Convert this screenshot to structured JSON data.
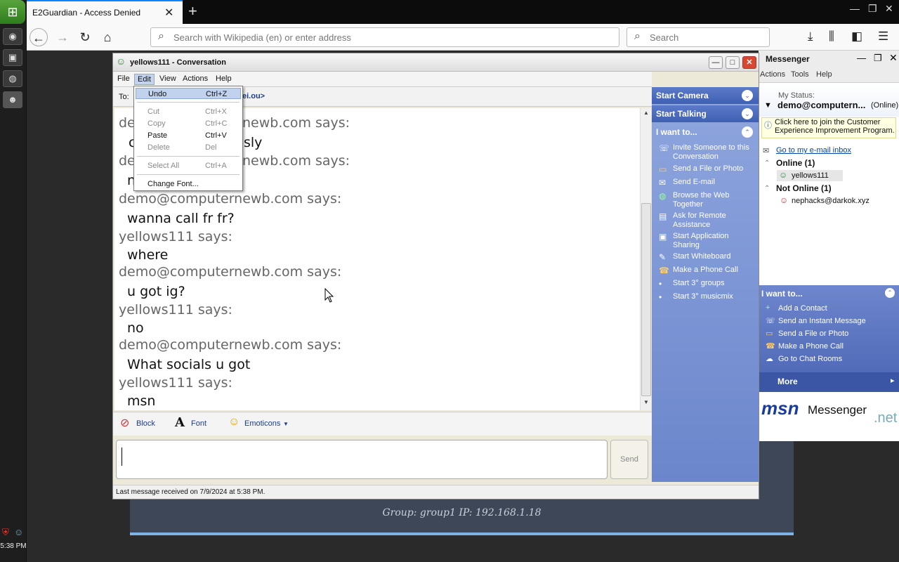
{
  "browser": {
    "tab_title": "E2Guardian - Access Denied",
    "tab_close": "✕",
    "new_tab": "+",
    "url_placeholder": "Search with Wikipedia (en) or enter address",
    "search_placeholder": "Search"
  },
  "taskbar": {
    "clock": "5:38 PM"
  },
  "background_panel": {
    "text": "Group: group1   IP: 192.168.1.18"
  },
  "conversation": {
    "title": "yellows111 - Conversation",
    "menu": [
      "File",
      "Edit",
      "View",
      "Actions",
      "Help"
    ],
    "to_label": "To:",
    "to_suffix": "ei.ou>",
    "messages": [
      {
        "sender": "demo@computernewb.com says:",
        "text": "casually"
      },
      {
        "sender": "demo@computernewb.com says:",
        "text": "n"
      },
      {
        "sender": "demo@computernewb.com says:",
        "text": "wanna call fr fr?"
      },
      {
        "sender": "yellows111 says:",
        "text": "where"
      },
      {
        "sender": "demo@computernewb.com says:",
        "text": "u got ig?"
      },
      {
        "sender": "yellows111 says:",
        "text": "no"
      },
      {
        "sender": "demo@computernewb.com says:",
        "text": "What socials u got"
      },
      {
        "sender": "yellows111 says:",
        "text": "msn"
      }
    ],
    "visible_fragments": {
      "line1_tail": "sly",
      "sender_tail_1": "newb.com says:",
      "sender_tail_2": "newb.com says:",
      "prefix_1": "c",
      "prefix_2": "de",
      "prefix_3": "de"
    },
    "toolbar": {
      "block": "Block",
      "font": "Font",
      "emoticons": "Emoticons"
    },
    "send_label": "Send",
    "status_text": "Last message received on 7/9/2024 at 5:38 PM."
  },
  "edit_menu": {
    "items": [
      {
        "label": "Undo",
        "shortcut": "Ctrl+Z",
        "enabled": true,
        "highlighted": true
      },
      {
        "label": "Cut",
        "shortcut": "Ctrl+X",
        "enabled": false
      },
      {
        "label": "Copy",
        "shortcut": "Ctrl+C",
        "enabled": false
      },
      {
        "label": "Paste",
        "shortcut": "Ctrl+V",
        "enabled": true
      },
      {
        "label": "Delete",
        "shortcut": "Del",
        "enabled": false
      },
      {
        "label": "Select All",
        "shortcut": "Ctrl+A",
        "enabled": false
      },
      {
        "label": "Change Font...",
        "shortcut": "",
        "enabled": true
      }
    ]
  },
  "conv_side": {
    "start_camera": "Start Camera",
    "start_talking": "Start Talking",
    "i_want_to": "I want to...",
    "actions": [
      "Invite Someone to this Conversation",
      "Send a File or Photo",
      "Send E-mail",
      "Browse the Web Together",
      "Ask for Remote Assistance",
      "Start Application Sharing",
      "Start Whiteboard",
      "Make a Phone Call",
      "Start 3° groups",
      "Start 3° musicmix"
    ]
  },
  "messenger": {
    "title": "Messenger",
    "menu": [
      "Actions",
      "Tools",
      "Help"
    ],
    "my_status_label": "My Status:",
    "account": "demo@computern...",
    "presence": "(Online)",
    "notice": "Click here to join the Customer Experience Improvement Program.",
    "inbox_link": "Go to my e-mail inbox",
    "online_group": "Online (1)",
    "online_contact": "yellows111",
    "offline_group": "Not Online (1)",
    "offline_contact": "nephacks@darkok.xyz",
    "i_want_to": "I want to...",
    "actions": [
      "Add a Contact",
      "Send an Instant Message",
      "Send a File or Photo",
      "Make a Phone Call",
      "Go to Chat Rooms"
    ],
    "more": "More",
    "brand_msn": "msn",
    "brand_messenger": "Messenger",
    "brand_net": ".net"
  }
}
